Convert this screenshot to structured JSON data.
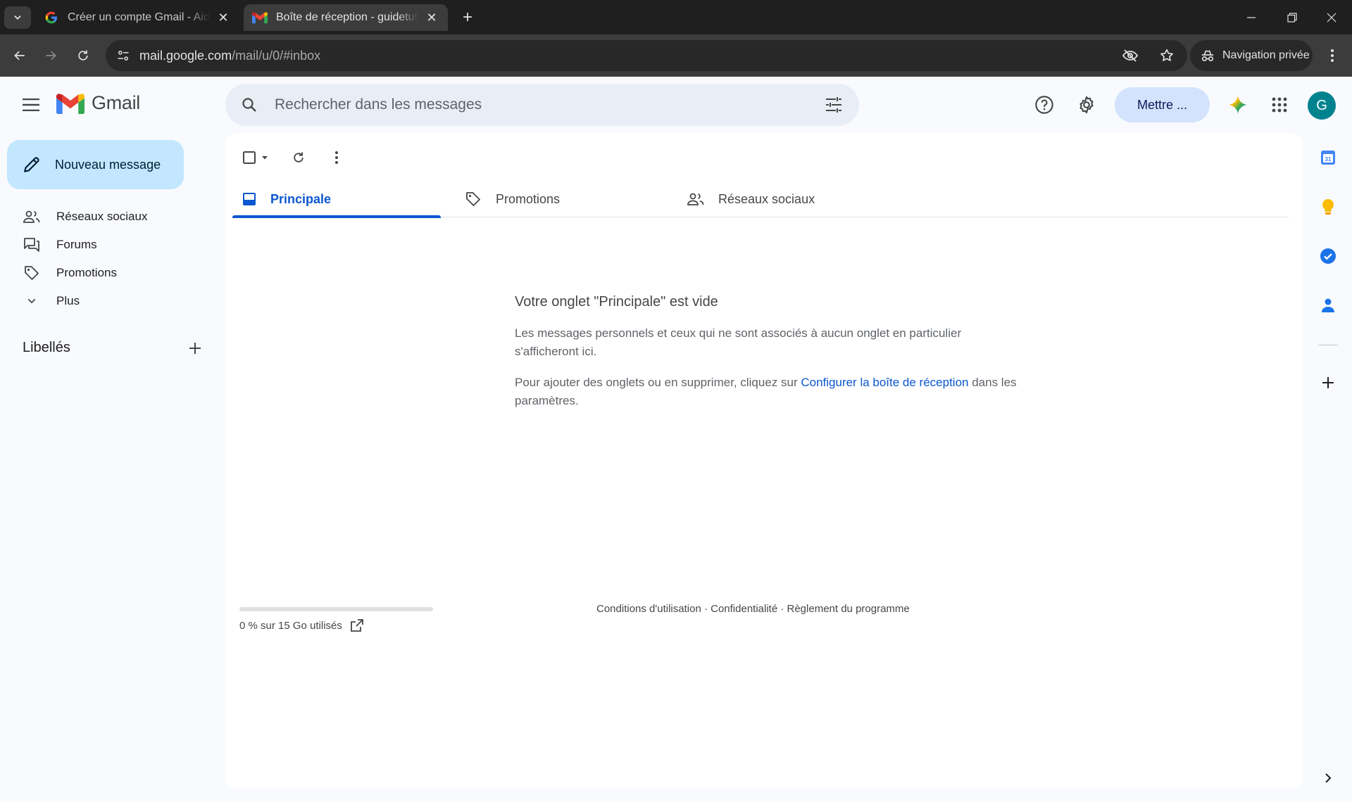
{
  "browser": {
    "tabs": [
      {
        "title": "Créer un compte Gmail - Aide Gmail",
        "favicon": "google-g-icon",
        "active": false
      },
      {
        "title": "Boîte de réception - guidetutog",
        "favicon": "gmail-icon",
        "active": true
      }
    ],
    "url_host": "mail.google.com",
    "url_path": "/mail/u/0/#inbox",
    "incognito_label": "Navigation privée"
  },
  "header": {
    "app_name": "Gmail",
    "search_placeholder": "Rechercher dans les messages",
    "upgrade_label": "Mettre ...",
    "avatar_letter": "G",
    "accent": "#0b57d0"
  },
  "sidebar": {
    "compose_label": "Nouveau message",
    "items": [
      {
        "label": "Réseaux sociaux",
        "icon": "people-icon"
      },
      {
        "label": "Forums",
        "icon": "forum-icon"
      },
      {
        "label": "Promotions",
        "icon": "tag-icon"
      },
      {
        "label": "Plus",
        "icon": "chevron-down-icon"
      }
    ],
    "labels_heading": "Libellés"
  },
  "main": {
    "tabs": [
      {
        "label": "Principale",
        "icon": "inbox-icon",
        "active": true
      },
      {
        "label": "Promotions",
        "icon": "tag-icon",
        "active": false
      },
      {
        "label": "Réseaux sociaux",
        "icon": "people-icon",
        "active": false
      }
    ],
    "empty_title": "Votre onglet \"Principale\" est vide",
    "empty_text1": "Les messages personnels et ceux qui ne sont associés à aucun onglet en particulier s'afficheront ici.",
    "empty_text2_prefix": "Pour ajouter des onglets ou en supprimer, cliquez sur ",
    "empty_text2_link": "Configurer la boîte de réception",
    "empty_text2_suffix": " dans les paramètres.",
    "storage_text": "0 % sur 15 Go utilisés",
    "storage_fraction": 0,
    "footer_links": "Conditions d'utilisation · Confidentialité · Règlement du programme"
  }
}
